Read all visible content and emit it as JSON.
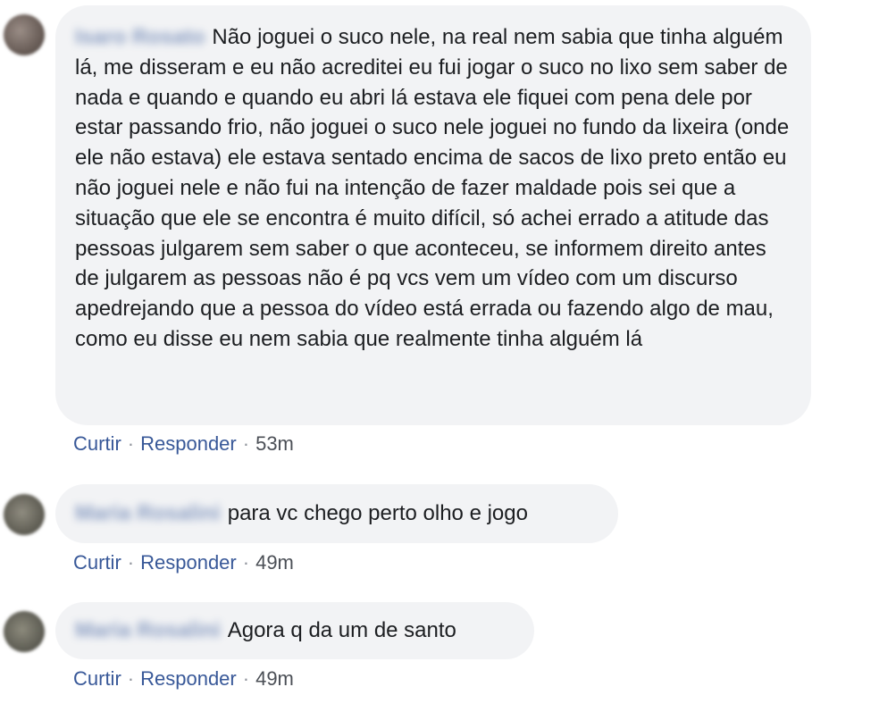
{
  "comments": [
    {
      "author": "Isaro Rosato",
      "text": "Não joguei o suco nele, na real nem sabia que tinha alguém lá, me disseram e eu não acreditei eu fui jogar o suco no lixo sem saber de nada e quando e quando eu abri lá estava ele fiquei com pena dele por estar passando frio, não joguei o suco nele joguei no fundo da lixeira (onde ele não estava) ele estava sentado encima de sacos de lixo preto então eu não joguei nele e não fui na intenção de fazer maldade pois sei que a situação que ele se encontra é muito difícil, só achei errado a atitude das pessoas julgarem sem saber o que aconteceu, se informem direito antes de julgarem as pessoas não é pq vcs vem um vídeo com um discurso apedrejando que a pessoa do vídeo está errada ou fazendo algo de mau, como eu disse eu nem sabia que realmente tinha alguém lá",
      "like_label": "Curtir",
      "reply_label": "Responder",
      "time": "53m"
    },
    {
      "author": "Maria Rosalini",
      "text": "para vc chego perto olho e jogo",
      "like_label": "Curtir",
      "reply_label": "Responder",
      "time": "49m"
    },
    {
      "author": "Maria Rosalini",
      "text": "Agora q da um de santo",
      "like_label": "Curtir",
      "reply_label": "Responder",
      "time": "49m"
    }
  ],
  "separator": "·"
}
